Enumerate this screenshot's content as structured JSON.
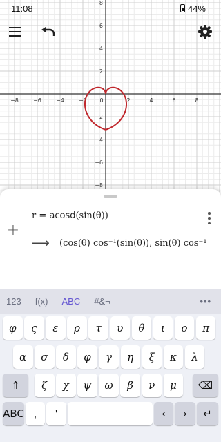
{
  "status_bar": {
    "time": "11:08",
    "battery": "44%"
  },
  "graph": {
    "x_ticks": [
      "−8",
      "−6",
      "−4",
      "−2",
      "0",
      "2",
      "4",
      "6",
      "8"
    ],
    "y_ticks": [
      "8",
      "6",
      "4",
      "2",
      "−2",
      "−4",
      "−6",
      "−8"
    ],
    "curve_color": "#c0282d"
  },
  "toolbar": {
    "menu_icon": "menu-icon",
    "undo_icon": "undo-icon",
    "settings_icon": "gear-icon"
  },
  "expression": {
    "input_lhs": "r = ",
    "input_fn": "acosd",
    "input_arg": "(sin(θ))",
    "output": "(cos(θ) cos⁻¹(sin(θ)), sin(θ) cos⁻¹"
  },
  "keyboard": {
    "tabs": [
      "123",
      "f(x)",
      "ABC",
      "#&¬"
    ],
    "active_tab": "ABC",
    "more": "•••",
    "row1": [
      "φ",
      "ς",
      "ε",
      "ρ",
      "τ",
      "υ",
      "θ",
      "ι",
      "ο",
      "π"
    ],
    "row2": [
      "α",
      "σ",
      "δ",
      "φ",
      "γ",
      "η",
      "ξ",
      "κ",
      "λ"
    ],
    "row3": [
      "ζ",
      "χ",
      "ψ",
      "ω",
      "β",
      "ν",
      "μ"
    ],
    "shift": "⇑",
    "backspace": "⌫",
    "abc": "ABC",
    "comma": ",",
    "apostrophe": "'",
    "left": "‹",
    "right": "›",
    "enter": "↵"
  }
}
